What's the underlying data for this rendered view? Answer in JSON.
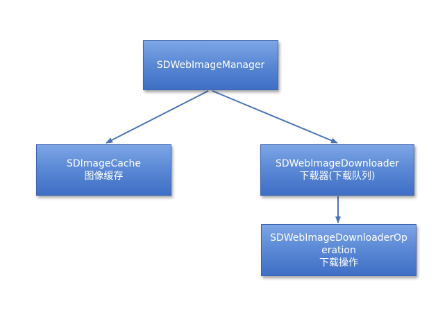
{
  "nodes": {
    "manager": {
      "line1": "SDWebImageManager"
    },
    "cache": {
      "line1": "SDImageCache",
      "line2": "图像缓存"
    },
    "downloader": {
      "line1": "SDWebImageDownloader",
      "line2": "下载器(下载队列)"
    },
    "operation": {
      "line1": "SDWebImageDownloaderOp",
      "line2": "eration",
      "line3": "下载操作"
    }
  },
  "colors": {
    "node_fill": "#5c8ad6",
    "node_border": "#3b64b0",
    "edge": "#4a72b8",
    "text": "#ffffff"
  }
}
